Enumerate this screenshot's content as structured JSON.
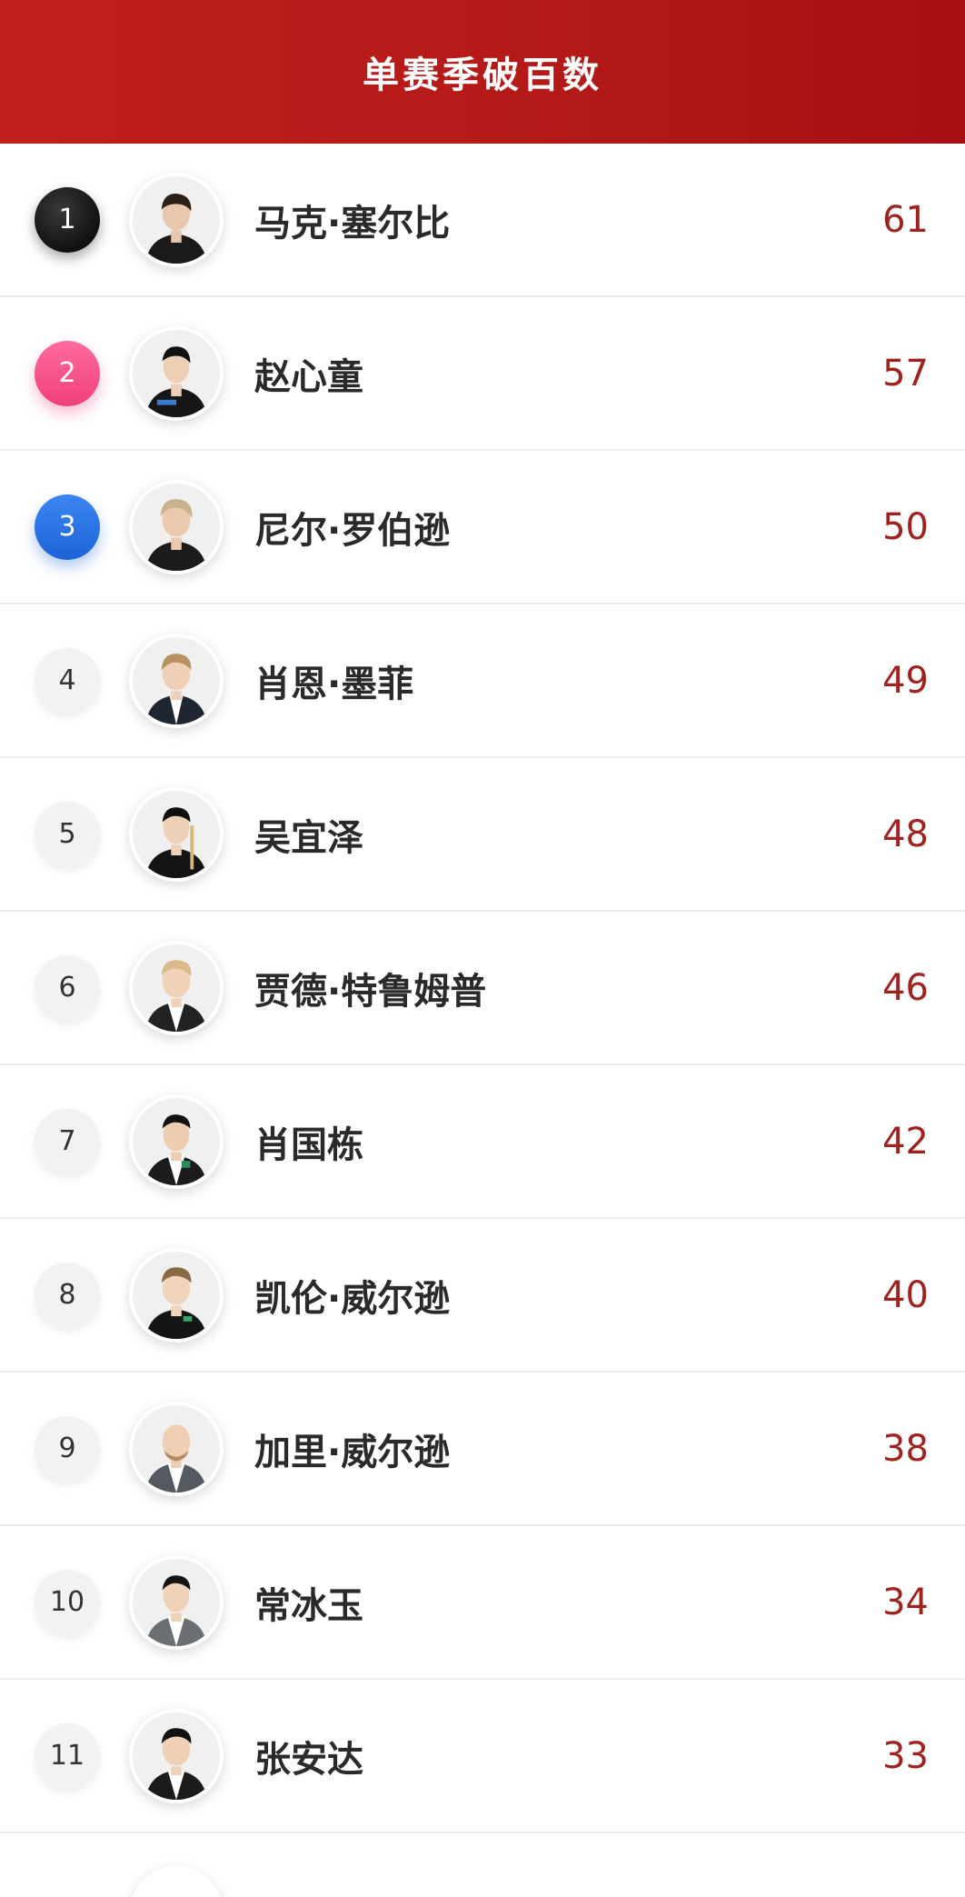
{
  "header": {
    "title": "单赛季破百数"
  },
  "rows": [
    {
      "rank": "1",
      "name": "马克·塞尔比",
      "value": "61"
    },
    {
      "rank": "2",
      "name": "赵心童",
      "value": "57"
    },
    {
      "rank": "3",
      "name": "尼尔·罗伯逊",
      "value": "50"
    },
    {
      "rank": "4",
      "name": "肖恩·墨菲",
      "value": "49"
    },
    {
      "rank": "5",
      "name": "吴宜泽",
      "value": "48"
    },
    {
      "rank": "6",
      "name": "贾德·特鲁姆普",
      "value": "46"
    },
    {
      "rank": "7",
      "name": "肖国栋",
      "value": "42"
    },
    {
      "rank": "8",
      "name": "凯伦·威尔逊",
      "value": "40"
    },
    {
      "rank": "9",
      "name": "加里·威尔逊",
      "value": "38"
    },
    {
      "rank": "10",
      "name": "常冰玉",
      "value": "34"
    },
    {
      "rank": "11",
      "name": "张安达",
      "value": "33"
    }
  ],
  "colors": {
    "header_bg": "#b31918",
    "value_text": "#a0221e",
    "rank1_badge": "#111111",
    "rank2_badge": "#ef3f7a",
    "rank3_badge": "#1e63d8"
  }
}
